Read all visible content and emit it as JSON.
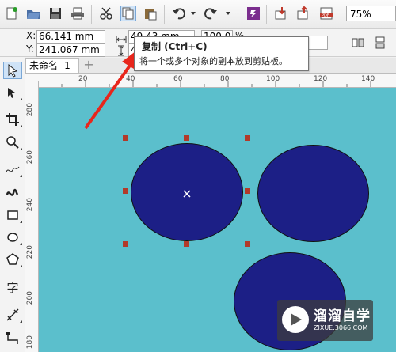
{
  "toolbar": {
    "icons": [
      "new-icon",
      "open-icon",
      "save-icon",
      "print-icon",
      "cut-icon",
      "copy-icon",
      "paste-icon",
      "undo-icon",
      "redo-icon",
      "app-launcher-icon",
      "import-icon",
      "export-icon",
      "publish-pdf-icon"
    ],
    "zoom": "75%"
  },
  "propbar": {
    "x_label": "X:",
    "x_value": "66.141 mm",
    "y_label": "Y:",
    "y_value": "241.067 mm",
    "width_value": "49.43 mm",
    "height_value_partial": "42",
    "scale_value": "100.0",
    "scale_unit": "%"
  },
  "tooltip": {
    "title": "复制 (Ctrl+C)",
    "description": "将一个或多个对象的副本放到剪贴板。"
  },
  "tabs": {
    "doc_tab": "未命名 -1",
    "add_tab": "+"
  },
  "rulers": {
    "h": [
      "20",
      "40",
      "60",
      "80",
      "100",
      "120",
      "140"
    ],
    "v": [
      "280",
      "260",
      "240",
      "220",
      "200",
      "180"
    ]
  },
  "canvas": {
    "background": "#5bbfcc",
    "shape_color": "#1c1f86",
    "handle_color": "#b23a2a"
  },
  "watermark": {
    "title": "溜溜自学",
    "sub": "ZIXUE.3066.COM"
  },
  "colors": {
    "arrow": "#e8261c"
  }
}
